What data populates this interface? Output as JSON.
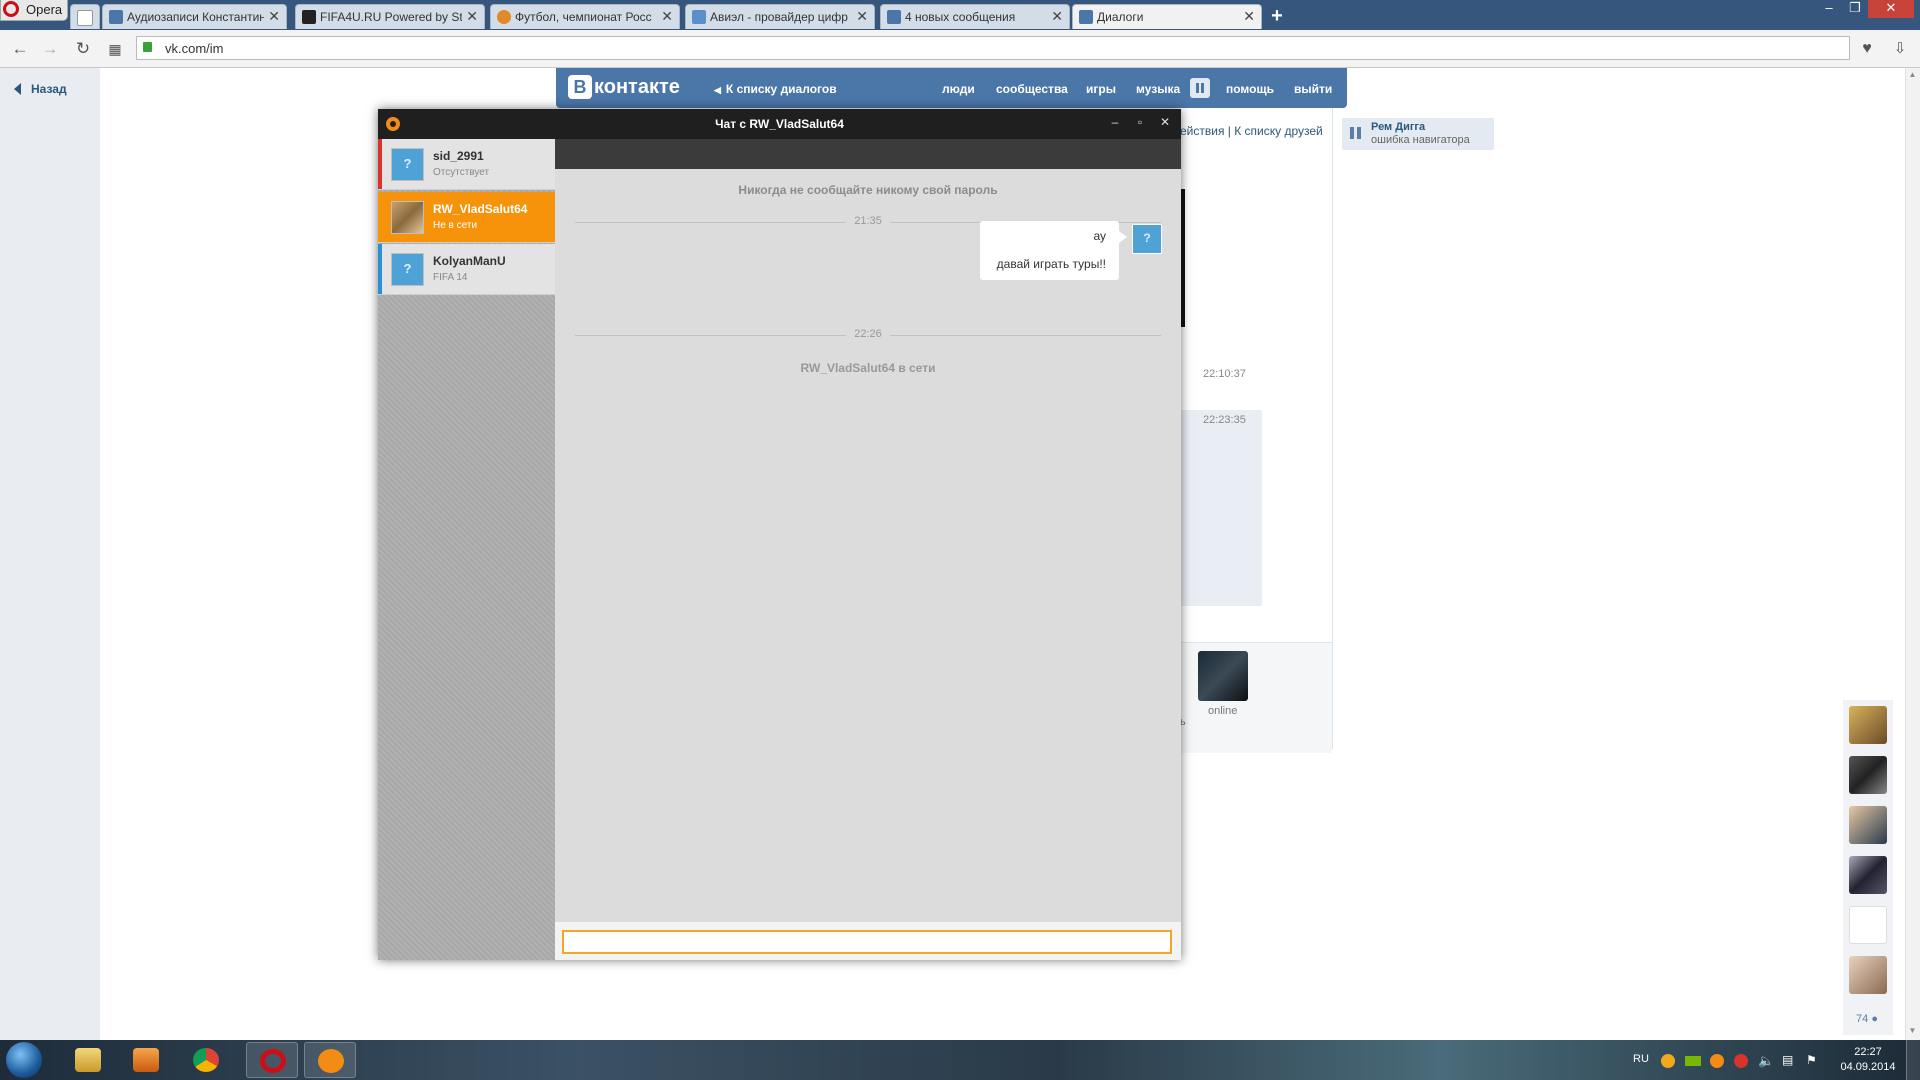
{
  "browser": {
    "menu_label": "Opera",
    "tabs": [
      {
        "title": "Аудиозаписи Константин",
        "color": "#4a76a8"
      },
      {
        "title": "FIFA4U.RU Powered by St",
        "color": "#222222"
      },
      {
        "title": "Футбол, чемпионат Росс",
        "color": "#e08a2a"
      },
      {
        "title": "Авиэл - провайдер цифр",
        "color": "#5b8fc9"
      },
      {
        "title": "4 новых сообщения",
        "color": "#4a76a8"
      },
      {
        "title": "Диалоги",
        "color": "#4a76a8"
      }
    ],
    "new_tab_label": "+",
    "url": "vk.com/im",
    "window_controls": {
      "minimize": "‒",
      "restore": "❐",
      "close": "✕"
    }
  },
  "page": {
    "back_label": "Назад",
    "vk": {
      "logo_letter": "В",
      "logo_text": "контакте",
      "back_to_dialogs": "К списку диалогов",
      "nav": [
        "люди",
        "сообщества",
        "игры",
        "музыка",
        "помощь",
        "выйти"
      ]
    },
    "bg_links": "ействия  |  К списку друзей",
    "bg_times": [
      "22:10:37",
      "22:23:35"
    ],
    "friend_status": "online",
    "friend_partial": "ь",
    "audio": {
      "artist": "Рем Дигга",
      "track": "ошибка навигатора"
    },
    "right_friends_count": "74"
  },
  "chat": {
    "title": "Чат с RW_VladSalut64",
    "window_controls": {
      "minimize": "‒",
      "maximize": "▫",
      "close": "✕"
    },
    "contacts": [
      {
        "name": "sid_2991",
        "status": "Отсутствует",
        "bar_color": "#d9342b"
      },
      {
        "name": "RW_VladSalut64",
        "status": "Не в сети",
        "bar_color": "#f6930a"
      },
      {
        "name": "KolyanManU",
        "status": "FIFA 14",
        "bar_color": "#2c8fd6"
      }
    ],
    "warning": "Никогда не сообщайте никому свой пароль",
    "divider_times": [
      "21:35",
      "22:26"
    ],
    "messages": [
      "ау",
      "давай играть туры!!"
    ],
    "online_notice": "RW_VladSalut64 в сети",
    "input_value": ""
  },
  "taskbar": {
    "language": "RU",
    "time": "22:27",
    "date": "04.09.2014"
  },
  "colors": {
    "vk_blue": "#4a76a8",
    "origin_orange": "#f6930a",
    "taskbar_dark": "#1e2c3a"
  }
}
